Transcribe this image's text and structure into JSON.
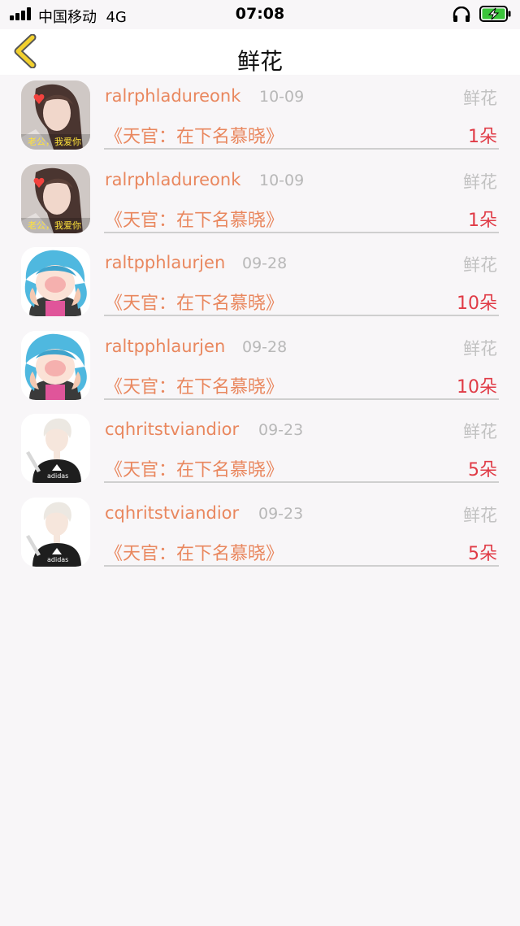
{
  "status_bar": {
    "carrier": "中国移动",
    "network": "4G",
    "time": "07:08"
  },
  "nav": {
    "title": "鲜花"
  },
  "items": [
    {
      "username": "ralrphladureonk",
      "date": "10-09",
      "tag": "鲜花",
      "book": "《天官：在下名慕晓》",
      "count": "1朵",
      "avatar": "avatar-girl"
    },
    {
      "username": "ralrphladureonk",
      "date": "10-09",
      "tag": "鲜花",
      "book": "《天官：在下名慕晓》",
      "count": "1朵",
      "avatar": "avatar-girl"
    },
    {
      "username": "raltpphlaurjen",
      "date": "09-28",
      "tag": "鲜花",
      "book": "《天官：在下名慕晓》",
      "count": "10朵",
      "avatar": "avatar-cartoon-blue-hair"
    },
    {
      "username": "raltpphlaurjen",
      "date": "09-28",
      "tag": "鲜花",
      "book": "《天官：在下名慕晓》",
      "count": "10朵",
      "avatar": "avatar-cartoon-blue-hair"
    },
    {
      "username": "cqhritstviandior",
      "date": "09-23",
      "tag": "鲜花",
      "book": "《天官：在下名慕晓》",
      "count": "5朵",
      "avatar": "avatar-anime-boy"
    },
    {
      "username": "cqhritstviandior",
      "date": "09-23",
      "tag": "鲜花",
      "book": "《天官：在下名慕晓》",
      "count": "5朵",
      "avatar": "avatar-anime-boy"
    }
  ],
  "colors": {
    "accent": "#e9875e",
    "count": "#e03b46",
    "back_arrow": "#f2d02e",
    "battery": "#3ac43a"
  }
}
